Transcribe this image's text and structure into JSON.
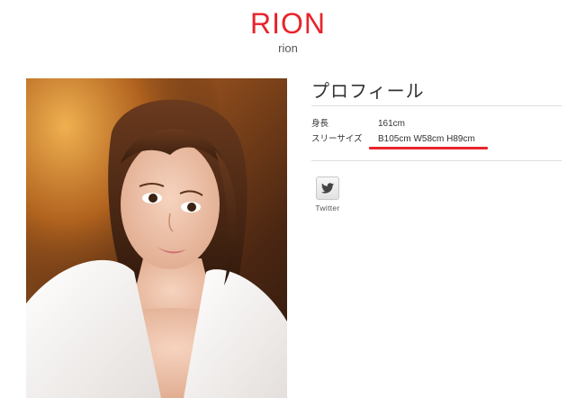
{
  "header": {
    "name": "RION",
    "name_romaji": "rion"
  },
  "profile": {
    "title": "プロフィール",
    "rows": [
      {
        "label": "身長",
        "value": "161cm"
      },
      {
        "label": "スリーサイズ",
        "value": "B105cm W58cm H89cm"
      }
    ]
  },
  "social": {
    "twitter_label": "Twitter",
    "twitter_icon": "twitter-bird-icon"
  },
  "colors": {
    "accent": "#e8232a",
    "text": "#333333",
    "divider": "#dddddd"
  }
}
